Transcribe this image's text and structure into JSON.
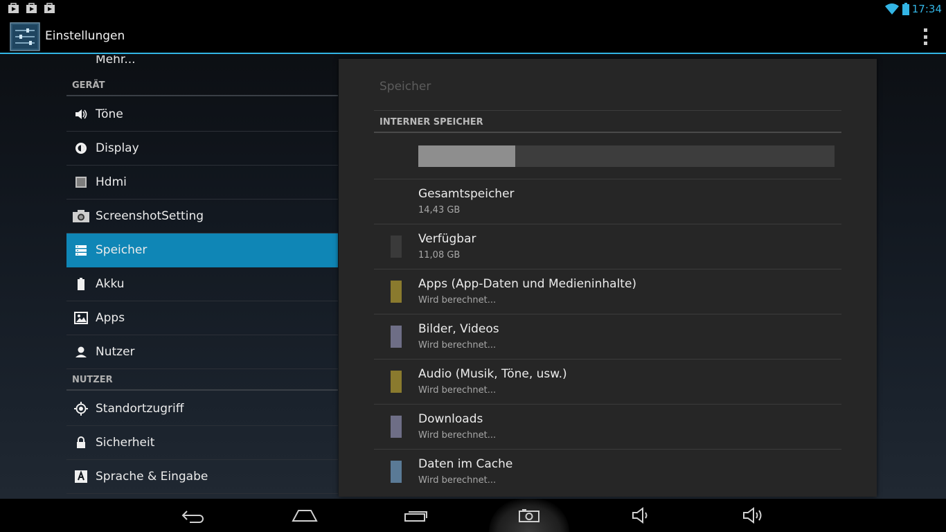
{
  "status_bar": {
    "time": "17:34",
    "notification_icons": [
      "play-store-icon",
      "play-store-icon",
      "play-store-icon"
    ],
    "right_icons": [
      "wifi-icon",
      "battery-icon"
    ]
  },
  "action_bar": {
    "title": "Einstellungen",
    "app_icon": "settings-app-icon",
    "overflow_icon": "overflow-menu-icon"
  },
  "left_pane": {
    "more_label": "Mehr...",
    "categories": [
      {
        "header": "GERÄT",
        "items": [
          {
            "label": "Töne",
            "icon": "volume-icon"
          },
          {
            "label": "Display",
            "icon": "brightness-icon"
          },
          {
            "label": "Hdmi",
            "icon": "hdmi-icon"
          },
          {
            "label": "ScreenshotSetting",
            "icon": "camera-icon"
          },
          {
            "label": "Speicher",
            "icon": "storage-icon",
            "selected": true
          },
          {
            "label": "Akku",
            "icon": "battery-icon"
          },
          {
            "label": "Apps",
            "icon": "apps-icon"
          },
          {
            "label": "Nutzer",
            "icon": "user-icon"
          }
        ]
      },
      {
        "header": "NUTZER",
        "items": [
          {
            "label": "Standortzugriff",
            "icon": "location-icon"
          },
          {
            "label": "Sicherheit",
            "icon": "lock-icon"
          },
          {
            "label": "Sprache & Eingabe",
            "icon": "language-icon"
          }
        ]
      }
    ]
  },
  "detail": {
    "title": "Speicher",
    "section_header": "INTERNER SPEICHER",
    "usage_fraction": 0.233,
    "rows": [
      {
        "title": "Gesamtspeicher",
        "subtitle": "14,43 GB",
        "color": ""
      },
      {
        "title": "Verfügbar",
        "subtitle": "11,08 GB",
        "color": "#3a3a3a"
      },
      {
        "title": "Apps (App-Daten und Medieninhalte)",
        "subtitle": "Wird berechnet...",
        "color": "#8a7a2e"
      },
      {
        "title": "Bilder, Videos",
        "subtitle": "Wird berechnet...",
        "color": "#6e6e86"
      },
      {
        "title": "Audio (Musik, Töne, usw.)",
        "subtitle": "Wird berechnet...",
        "color": "#8a7a2e"
      },
      {
        "title": "Downloads",
        "subtitle": "Wird berechnet...",
        "color": "#6e6e86"
      },
      {
        "title": "Daten im Cache",
        "subtitle": "Wird berechnet...",
        "color": "#5a7a96"
      }
    ]
  },
  "nav_bar": {
    "buttons": [
      "back-icon",
      "home-icon",
      "recent-apps-icon",
      "screenshot-icon",
      "volume-down-icon",
      "volume-up-icon"
    ]
  },
  "colors": {
    "accent": "#33b5e5",
    "selected": "#0f86b6"
  }
}
